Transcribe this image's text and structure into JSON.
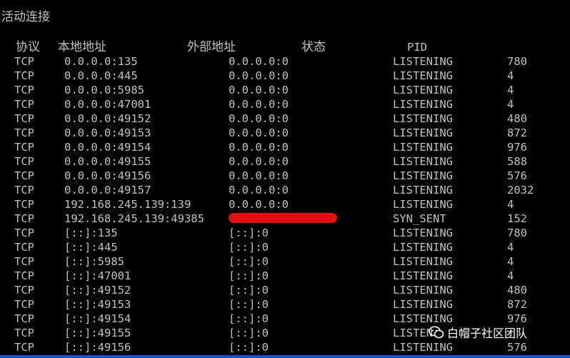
{
  "title": "活动连接",
  "header": {
    "proto": "协议",
    "local": "本地地址",
    "foreign": "外部地址",
    "state": "状态",
    "pid": "PID"
  },
  "rows": [
    {
      "proto": "TCP",
      "local": "0.0.0.0:135",
      "foreign": "0.0.0.0:0",
      "state": "LISTENING",
      "pid": "780"
    },
    {
      "proto": "TCP",
      "local": "0.0.0.0:445",
      "foreign": "0.0.0.0:0",
      "state": "LISTENING",
      "pid": "4"
    },
    {
      "proto": "TCP",
      "local": "0.0.0.0:5985",
      "foreign": "0.0.0.0:0",
      "state": "LISTENING",
      "pid": "4"
    },
    {
      "proto": "TCP",
      "local": "0.0.0.0:47001",
      "foreign": "0.0.0.0:0",
      "state": "LISTENING",
      "pid": "4"
    },
    {
      "proto": "TCP",
      "local": "0.0.0.0:49152",
      "foreign": "0.0.0.0:0",
      "state": "LISTENING",
      "pid": "480"
    },
    {
      "proto": "TCP",
      "local": "0.0.0.0:49153",
      "foreign": "0.0.0.0:0",
      "state": "LISTENING",
      "pid": "872"
    },
    {
      "proto": "TCP",
      "local": "0.0.0.0:49154",
      "foreign": "0.0.0.0:0",
      "state": "LISTENING",
      "pid": "976"
    },
    {
      "proto": "TCP",
      "local": "0.0.0.0:49155",
      "foreign": "0.0.0.0:0",
      "state": "LISTENING",
      "pid": "588"
    },
    {
      "proto": "TCP",
      "local": "0.0.0.0:49156",
      "foreign": "0.0.0.0:0",
      "state": "LISTENING",
      "pid": "576"
    },
    {
      "proto": "TCP",
      "local": "0.0.0.0:49157",
      "foreign": "0.0.0.0:0",
      "state": "LISTENING",
      "pid": "2032"
    },
    {
      "proto": "TCP",
      "local": "192.168.245.139:139",
      "foreign": "0.0.0.0:0",
      "state": "LISTENING",
      "pid": "4"
    },
    {
      "proto": "TCP",
      "local": "192.168.245.139:49385",
      "foreign": "          ",
      "state": "SYN_SENT",
      "pid": "152"
    },
    {
      "proto": "TCP",
      "local": "[::]:135",
      "foreign": "[::]:0",
      "state": "LISTENING",
      "pid": "780"
    },
    {
      "proto": "TCP",
      "local": "[::]:445",
      "foreign": "[::]:0",
      "state": "LISTENING",
      "pid": "4"
    },
    {
      "proto": "TCP",
      "local": "[::]:5985",
      "foreign": "[::]:0",
      "state": "LISTENING",
      "pid": "4"
    },
    {
      "proto": "TCP",
      "local": "[::]:47001",
      "foreign": "[::]:0",
      "state": "LISTENING",
      "pid": "4"
    },
    {
      "proto": "TCP",
      "local": "[::]:49152",
      "foreign": "[::]:0",
      "state": "LISTENING",
      "pid": "480"
    },
    {
      "proto": "TCP",
      "local": "[::]:49153",
      "foreign": "[::]:0",
      "state": "LISTENING",
      "pid": "872"
    },
    {
      "proto": "TCP",
      "local": "[::]:49154",
      "foreign": "[::]:0",
      "state": "LISTENING",
      "pid": "976"
    },
    {
      "proto": "TCP",
      "local": "[::]:49155",
      "foreign": "[::]:0",
      "state": "LISTEN",
      "pid": ""
    },
    {
      "proto": "TCP",
      "local": "[::]:49156",
      "foreign": "[::]:0",
      "state": "LISTENING",
      "pid": "576"
    }
  ],
  "watermark": {
    "icon": "wechat-icon",
    "text": "白帽子社区团队"
  },
  "colors": {
    "background": "#000000",
    "text": "#c0c0c0",
    "redaction": "#e01010",
    "taskbar": "#1a4fd0"
  }
}
